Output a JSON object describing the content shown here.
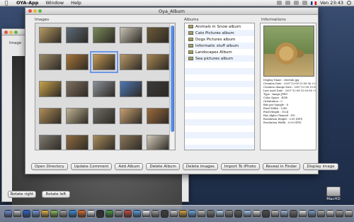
{
  "menubar": {
    "app_name": "OYA-App",
    "menus": [
      "Window",
      "Help"
    ],
    "clock": "Ven 23:43"
  },
  "bg_window": {
    "image_label": "Image",
    "rotate_right": "Rotate right",
    "rotate_left": "Rotate left"
  },
  "main_window": {
    "title": "Oya_Album",
    "images_label": "Images",
    "albums_label": "Albums",
    "info_label": "Informations"
  },
  "albums": [
    "Animals in Snow album",
    "Cats Pictures album",
    "Dogs Pictures album",
    "Informatic stuff album",
    "Landscapes Album",
    "Sea pictures album"
  ],
  "info": {
    "lines": [
      "Display Name : cheetah.jpg",
      "Creation Date : 2007-12-08 15:50:56 +0100",
      "Creation change Date : 2007-12-08 15:50:56 +0100",
      "Last used Date : 2007-12-08 15:50:56 +0100",
      "Type : Image JPEG",
      "Color Space : RGB",
      "Orientation : 0",
      "Bits per Sample : 8",
      "Pixel Width : 1280",
      "Pixel Height : 1024",
      "Has Alpha Channel : NO",
      "Resolution Height : 0.00 (DPI)",
      "Resolution Width : 0.00 (DPI)"
    ]
  },
  "buttons": [
    "Open Directory",
    "Update Comment",
    "Add Album",
    "Delete Album",
    "Delete images",
    "Import To iPhoto",
    "Reveal in Finder",
    "Display image"
  ],
  "desktop": {
    "hd_label": "MacHD"
  },
  "thumbnails": [
    "#b79b63",
    "#5d6b79",
    "#7a8b5a",
    "#c9c2b4",
    "#6b5a3a",
    "#9b8a68",
    "#a9753a",
    "#c59a55",
    "#b89a6a",
    "#a68652",
    "#c8a24a",
    "#7f7060",
    "#8b9199",
    "#4d77b4",
    "#3a3a3a",
    "#b08d58",
    "#c0b392",
    "#6f6d66",
    "#c7a071",
    "#9d6a3c",
    "#7d7a70",
    "#8f6c43",
    "#a98c5c",
    "#88755a",
    "#d2c9b9",
    "#a88a58",
    "#5a4d3c",
    "#b59e70",
    "#bda77c",
    "#9a8a72"
  ],
  "dock_colors": [
    "#6d8ed1",
    "#c7c7c7",
    "#2c62c9",
    "#7a9ad8",
    "#e7b544",
    "#8fbf5c",
    "#a6a6a6",
    "#3b8ed8",
    "#e06d2d",
    "#e5e5e5",
    "#2d2d2d",
    "#4b9a43",
    "#9d9d9d",
    "#c84b3a",
    "#5aa0e0",
    "#f1f1f1",
    "#a1a1a1",
    "#3f3f3f",
    "#d4d4d4",
    "#e0a838",
    "#6fa9e3",
    "#c2c2c2",
    "#7b7b7b",
    "#b7d3ef",
    "#8c8c8c",
    "#5e5e5e",
    "#a8c6e8",
    "#d9d9d9",
    "#4e4e4e",
    "#c0c0c0",
    "#9fb9d8",
    "#6c6c6c",
    "#e3e3e3",
    "#7f9fc2",
    "#b0b0b0",
    "#d8d8d8",
    "#a7a7a7",
    "#c9c9c9"
  ]
}
